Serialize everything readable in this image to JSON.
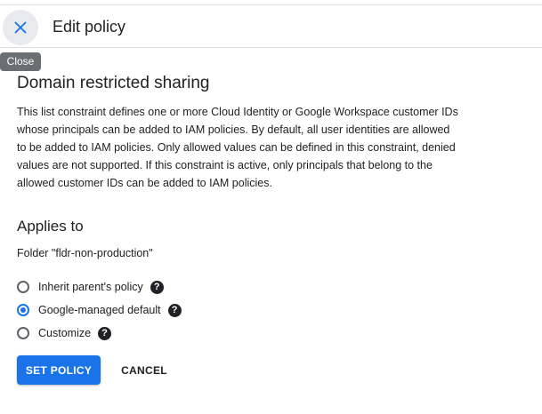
{
  "header": {
    "title": "Edit policy",
    "close_icon": "close-icon"
  },
  "tooltip": {
    "text": "Close"
  },
  "policy": {
    "title": "Domain restricted sharing",
    "description": "This list constraint defines one or more Cloud Identity or Google Workspace customer IDs whose principals can be added to IAM policies. By default, all user identities are allowed to be added to IAM policies. Only allowed values can be defined in this constraint, denied values are not supported. If this constraint is active, only principals that belong to the allowed customer IDs can be added to IAM policies."
  },
  "applies_to": {
    "title": "Applies to",
    "resource": "Folder \"fldr-non-production\"",
    "options": [
      {
        "label": "Inherit parent's policy",
        "selected": false,
        "help_icon": "help-icon"
      },
      {
        "label": "Google-managed default",
        "selected": true,
        "help_icon": "help-icon"
      },
      {
        "label": "Customize",
        "selected": false,
        "help_icon": "help-icon"
      }
    ]
  },
  "actions": {
    "set_policy_label": "SET POLICY",
    "cancel_label": "CANCEL"
  },
  "colors": {
    "accent": "#1a73e8",
    "text": "#202124",
    "tooltip_bg": "#6b6e72"
  }
}
